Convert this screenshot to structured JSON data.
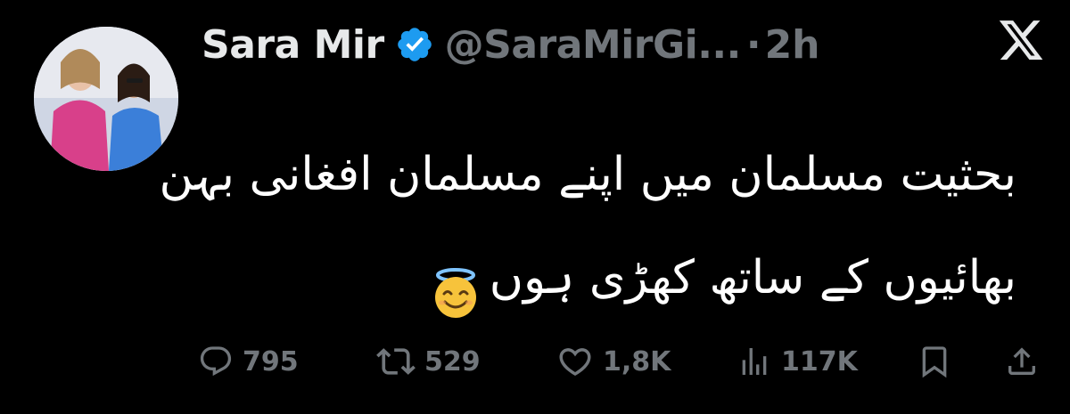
{
  "tweet": {
    "author_name": "Sara Mir",
    "handle": "@SaraMirGi...",
    "separator": "·",
    "time": "2h",
    "verified_icon": "verified-badge-icon",
    "platform_icon": "x-logo-icon",
    "body_line_1": "بحثیت مسلمان میں اپنے مسلمان افغانی بہن",
    "body_line_2": "بھائیوں کے ساتھ کھڑی ہوں",
    "emoji": "😇",
    "actions": {
      "reply_count": "795",
      "retweet_count": "529",
      "like_count": "1,8K",
      "views_count": "117K"
    }
  },
  "colors": {
    "background": "#000000",
    "text_primary": "#e7e9ea",
    "text_secondary": "#71767b",
    "verified_blue": "#1d9bf0"
  }
}
